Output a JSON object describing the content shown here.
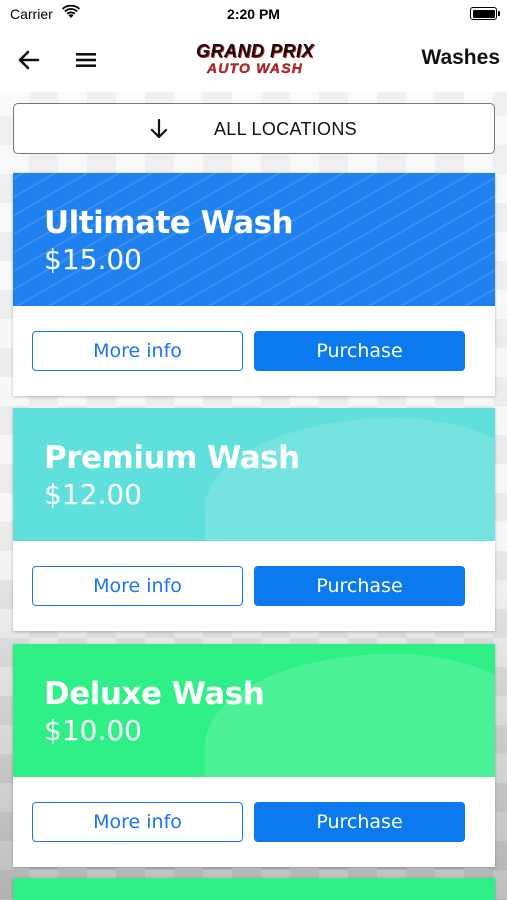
{
  "status_bar": {
    "carrier": "Carrier",
    "time": "2:20 PM"
  },
  "nav": {
    "title": "Washes",
    "logo_line1": "GRAND PRIX",
    "logo_line2": "AUTO WASH",
    "back_icon": "arrow-left-icon",
    "menu_icon": "hamburger-menu-icon"
  },
  "location_selector": {
    "label": "ALL LOCATIONS",
    "icon": "arrow-down-icon"
  },
  "washes": [
    {
      "name": "Ultimate Wash",
      "price": "$15.00",
      "color": "#1f80ef",
      "more_label": "More info",
      "purchase_label": "Purchase"
    },
    {
      "name": "Premium Wash",
      "price": "$12.00",
      "color": "#5fe0dc",
      "more_label": "More info",
      "purchase_label": "Purchase"
    },
    {
      "name": "Deluxe Wash",
      "price": "$10.00",
      "color": "#2ef087",
      "more_label": "More info",
      "purchase_label": "Purchase"
    }
  ],
  "next_card_color": "#2ef087",
  "colors": {
    "primary": "#0b7aef",
    "logo_red": "#e01b1b"
  }
}
